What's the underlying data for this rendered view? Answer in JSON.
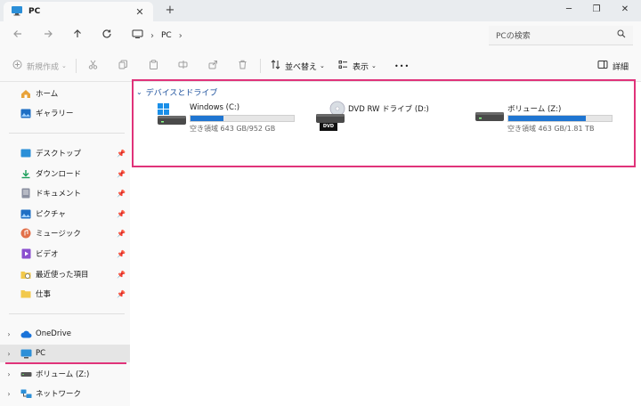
{
  "window": {
    "tab_title": "PC",
    "tab_close": "✕",
    "new_tab": "+",
    "minimize": "─",
    "maximize": "❐",
    "close": "✕"
  },
  "address": {
    "crumb": "PC",
    "search_placeholder": "PCの検索"
  },
  "toolbar": {
    "new_label": "新規作成",
    "sort_label": "並べ替え",
    "view_label": "表示",
    "more_label": "•••",
    "details_label": "詳細"
  },
  "sidebar": {
    "top": [
      {
        "label": "ホーム",
        "icon": "home-icon"
      },
      {
        "label": "ギャラリー",
        "icon": "gallery-icon"
      }
    ],
    "quick": [
      {
        "label": "デスクトップ",
        "icon": "desktop-icon"
      },
      {
        "label": "ダウンロード",
        "icon": "download-icon"
      },
      {
        "label": "ドキュメント",
        "icon": "document-icon"
      },
      {
        "label": "ピクチャ",
        "icon": "picture-icon"
      },
      {
        "label": "ミュージック",
        "icon": "music-icon"
      },
      {
        "label": "ビデオ",
        "icon": "video-icon"
      },
      {
        "label": "最近使った項目",
        "icon": "recent-icon"
      },
      {
        "label": "仕事",
        "icon": "folder-icon"
      }
    ],
    "bottom": [
      {
        "label": "OneDrive",
        "icon": "cloud-icon"
      },
      {
        "label": "PC",
        "icon": "pc-icon"
      },
      {
        "label": "ボリューム (Z:)",
        "icon": "drive-icon"
      },
      {
        "label": "ネットワーク",
        "icon": "network-icon"
      }
    ]
  },
  "main": {
    "group_title": "デバイスとドライブ",
    "drives": [
      {
        "name": "Windows (C:)",
        "free_text": "空き領域 643 GB/952 GB",
        "used_fraction": 0.32
      },
      {
        "name": "DVD RW ドライブ (D:)",
        "dvd_label": "DVD"
      },
      {
        "name": "ボリューム (Z:)",
        "free_text": "空き領域 463 GB/1.81 TB",
        "used_fraction": 0.75
      }
    ]
  },
  "colors": {
    "accent": "#1f75d1",
    "highlight": "#e0337a",
    "group_title": "#1a4f9c"
  }
}
